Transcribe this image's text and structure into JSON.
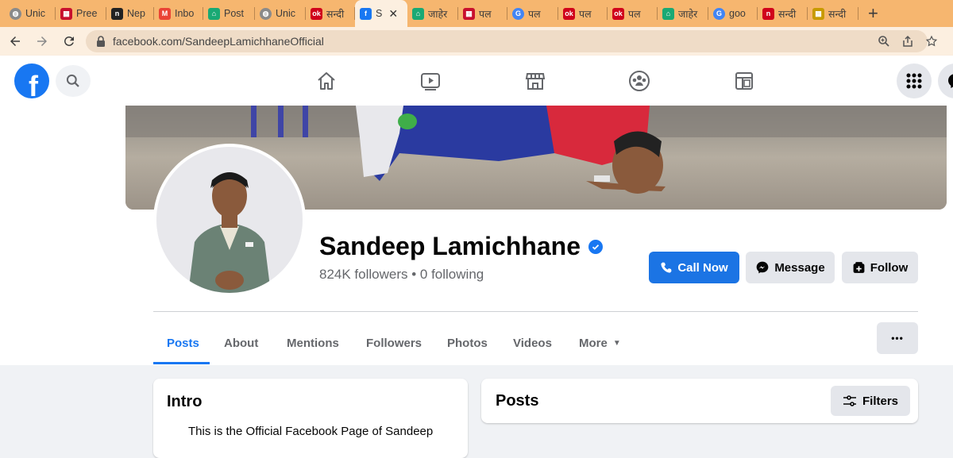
{
  "browser": {
    "tabs": [
      {
        "label": "Unic",
        "icon": "globe-icon",
        "color": "#8a8a8a"
      },
      {
        "label": "Pree",
        "icon": "news-icon",
        "color": "#c8102e"
      },
      {
        "label": "Nep",
        "icon": "n-logo-icon",
        "color": "#222222"
      },
      {
        "label": "Inbo",
        "icon": "gmail-icon",
        "color": "#ea4335"
      },
      {
        "label": "Post",
        "icon": "home-icon",
        "color": "#19a974"
      },
      {
        "label": "Unic",
        "icon": "globe-icon",
        "color": "#8a8a8a"
      },
      {
        "label": "सन्दी",
        "icon": "ok-icon",
        "color": "#d0021b"
      },
      {
        "label": "S",
        "icon": "facebook-icon",
        "color": "#1877f2",
        "active": true
      },
      {
        "label": "जाहेर",
        "icon": "home-icon",
        "color": "#19a974"
      },
      {
        "label": "पल",
        "icon": "news-icon",
        "color": "#c8102e"
      },
      {
        "label": "पल",
        "icon": "google-icon",
        "color": "#4285f4"
      },
      {
        "label": "पल",
        "icon": "ok-icon",
        "color": "#d0021b"
      },
      {
        "label": "पल",
        "icon": "ok-icon",
        "color": "#d0021b"
      },
      {
        "label": "जाहेर",
        "icon": "home-icon",
        "color": "#19a974"
      },
      {
        "label": "goo",
        "icon": "google-icon",
        "color": "#4285f4"
      },
      {
        "label": "सन्दी",
        "icon": "n-logo-icon",
        "color": "#d0021b"
      },
      {
        "label": "सन्दी",
        "icon": "news-icon",
        "color": "#c79a00"
      }
    ],
    "close_glyph": "✕",
    "new_tab_glyph": "+",
    "url": "facebook.com/SandeepLamichhaneOfficial"
  },
  "facebook": {
    "logo_letter": "f",
    "nav": [
      "home-icon",
      "watch-icon",
      "marketplace-icon",
      "groups-icon",
      "gaming-icon"
    ]
  },
  "profile": {
    "name": "Sandeep Lamichhane",
    "stats": "824K followers • 0 following",
    "buttons": {
      "call_now": "Call Now",
      "message": "Message",
      "follow": "Follow"
    }
  },
  "tabs": {
    "posts": "Posts",
    "about": "About",
    "mentions": "Mentions",
    "followers": "Followers",
    "photos": "Photos",
    "videos": "Videos",
    "more": "More",
    "more_caret": "▼",
    "overflow": "•••"
  },
  "intro": {
    "title": "Intro",
    "text": "This is the Official Facebook Page of Sandeep"
  },
  "posts": {
    "title": "Posts",
    "filters": "Filters"
  },
  "colors": {
    "accent": "#1877f2",
    "tabbar": "#f6b66f",
    "addrbar": "#fcefe0"
  }
}
